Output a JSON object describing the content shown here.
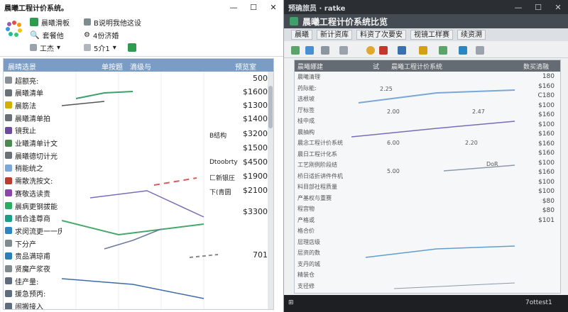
{
  "left_window": {
    "title": "晨曦工程计价系统。",
    "window_controls": {
      "minimize": "—",
      "maximize": "☐",
      "close": "✕"
    },
    "ribbon": {
      "project_name": "晨曦滑板",
      "options": "套餐他",
      "column_b": "B说明我他这设",
      "status": "4份济婚",
      "work_dropdown": "工杰",
      "count_dropdown": "5介1"
    },
    "grid_header": {
      "tree_label": "晨晴选景",
      "col_a": "单按题",
      "col_b": "滴级与",
      "col_price": "预览室"
    },
    "sidebar": [
      {
        "label": "超额亮:",
        "icon_color": "#8a8f96"
      },
      {
        "label": "晨曦清单",
        "icon_color": "#6a7078"
      },
      {
        "label": "晨筋法",
        "icon_color": "#d4b000"
      },
      {
        "label": "晨曦清单拍",
        "icon_color": "#6a7078"
      },
      {
        "label": "镜我止",
        "icon_color": "#6c4aa0"
      },
      {
        "label": "业曦清单计文",
        "icon_color": "#4a8a4e"
      },
      {
        "label": "晨曦德切计光",
        "icon_color": "#6a7078"
      },
      {
        "label": "稍能统之",
        "icon_color": "#7aa6d8"
      },
      {
        "label": "需散洗按文:",
        "icon_color": "#c0392b"
      },
      {
        "label": "赛敬选读责",
        "icon_color": "#8e44ad"
      },
      {
        "label": "晨病更钢拔能",
        "icon_color": "#27ae60"
      },
      {
        "label": "晒合逢尊商",
        "icon_color": "#16a085"
      },
      {
        "label": "求闵流更一一庆",
        "icon_color": "#2e86c1"
      },
      {
        "label": "下分产",
        "icon_color": "#7f8c8d"
      },
      {
        "label": "贵品满琼甫",
        "icon_color": "#2980b9"
      },
      {
        "label": "贤魔产浆夜",
        "icon_color": "#7f8c8d"
      },
      {
        "label": "佳产量:",
        "icon_color": "#5d6d7e"
      },
      {
        "label": "援急预丙:",
        "icon_color": "#5d6d7e"
      },
      {
        "label": "闹搬接入",
        "icon_color": "#5d6d7e"
      }
    ],
    "values": [
      "500",
      "$1600",
      "$1300",
      "$1400",
      "$3200",
      "$1500",
      "$4500",
      "$1900",
      "$2100",
      "$3300",
      "701"
    ],
    "cell_notes": {
      "row5": "B结构",
      "row7": "Dtoobrty",
      "row8": "匚新银圧",
      "row9": "下(青圆"
    }
  },
  "right_window": {
    "title": "预确旅员 · ratke",
    "header_title": "晨曦工程计价系统比览",
    "menu": [
      "晨曦",
      "新计资库",
      "料资了次要安",
      "视镜工样赛",
      "续资溯"
    ],
    "grid_header": {
      "col_a": "试",
      "col_b": "晨曦工程计价系统",
      "col_price": "数买清融"
    },
    "sidebar": [
      "晨曦清理",
      "药际能:",
      "选根坡",
      "厅标签",
      "桂中成",
      "晨抽构",
      "晨念工程计价系统",
      "晨日工程计化系",
      "工艺刚例阶段结",
      "桥日适折讲件件机",
      "料目部社程质量",
      "产基权与重赛",
      "程宫物",
      "产格或",
      "格合价",
      "层理店级",
      "层资的数",
      "支丹的城",
      "精装仓",
      "支径修"
    ],
    "mid_values": [
      "2.25",
      "2.00",
      "2.47",
      "6.00",
      "2.20",
      "5.00",
      "DoR"
    ],
    "values": [
      "180",
      "$160",
      "C180",
      "$100",
      "$160",
      "$100",
      "$160",
      "$160",
      "$160",
      "$100",
      "$160",
      "$100",
      "$100",
      "$80",
      "$80",
      "$101"
    ]
  },
  "taskbar": {
    "time": "7ottest1"
  }
}
